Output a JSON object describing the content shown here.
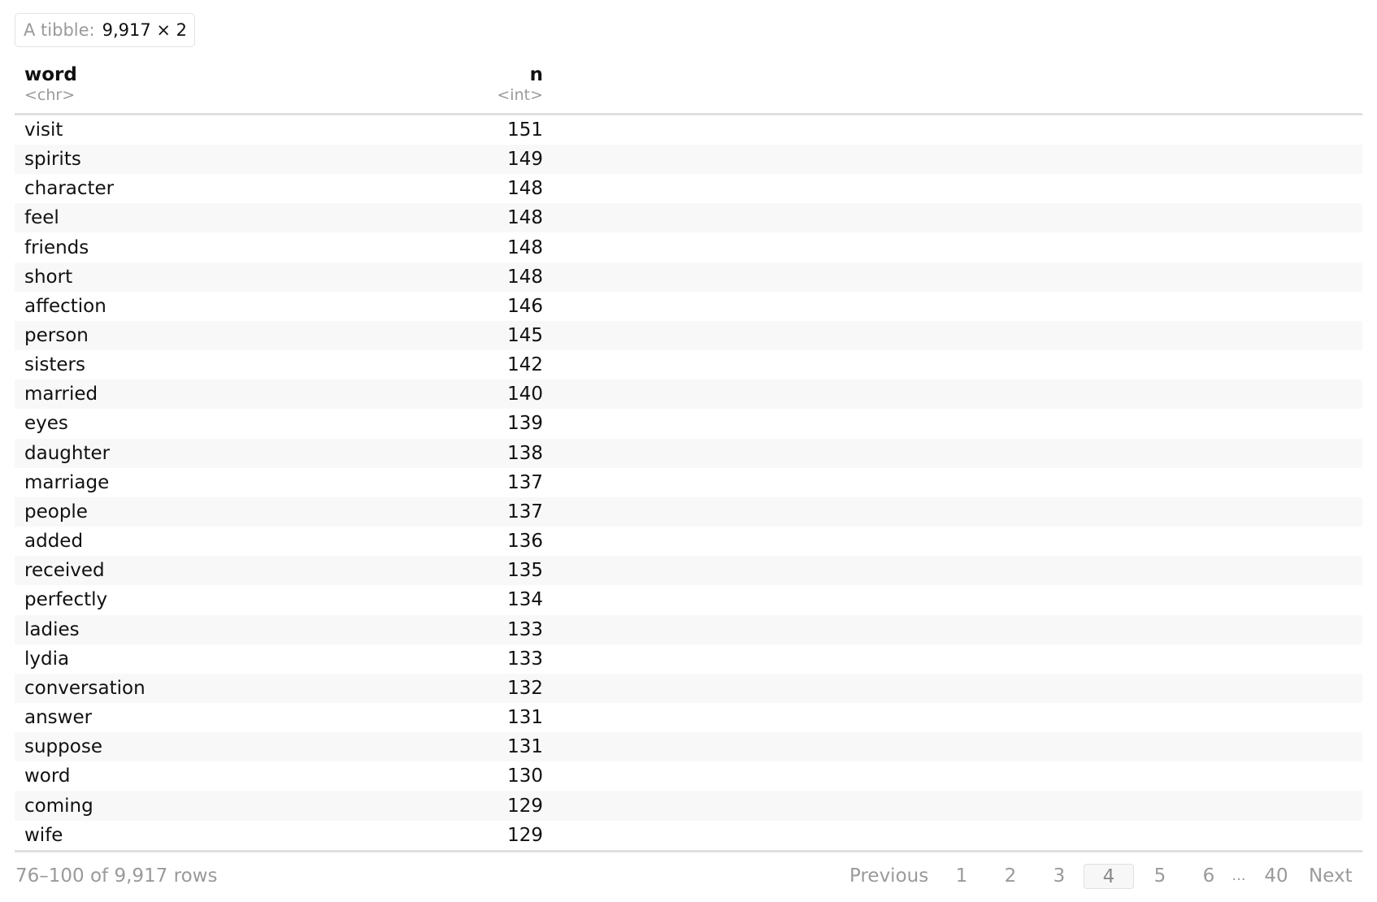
{
  "caption": {
    "label": "A tibble:",
    "dims": "9,917 × 2"
  },
  "columns": [
    {
      "name": "word",
      "type": "<chr>",
      "align": "left"
    },
    {
      "name": "n",
      "type": "<int>",
      "align": "right"
    }
  ],
  "rows": [
    {
      "word": "visit",
      "n": "151"
    },
    {
      "word": "spirits",
      "n": "149"
    },
    {
      "word": "character",
      "n": "148"
    },
    {
      "word": "feel",
      "n": "148"
    },
    {
      "word": "friends",
      "n": "148"
    },
    {
      "word": "short",
      "n": "148"
    },
    {
      "word": "affection",
      "n": "146"
    },
    {
      "word": "person",
      "n": "145"
    },
    {
      "word": "sisters",
      "n": "142"
    },
    {
      "word": "married",
      "n": "140"
    },
    {
      "word": "eyes",
      "n": "139"
    },
    {
      "word": "daughter",
      "n": "138"
    },
    {
      "word": "marriage",
      "n": "137"
    },
    {
      "word": "people",
      "n": "137"
    },
    {
      "word": "added",
      "n": "136"
    },
    {
      "word": "received",
      "n": "135"
    },
    {
      "word": "perfectly",
      "n": "134"
    },
    {
      "word": "ladies",
      "n": "133"
    },
    {
      "word": "lydia",
      "n": "133"
    },
    {
      "word": "conversation",
      "n": "132"
    },
    {
      "word": "answer",
      "n": "131"
    },
    {
      "word": "suppose",
      "n": "131"
    },
    {
      "word": "word",
      "n": "130"
    },
    {
      "word": "coming",
      "n": "129"
    },
    {
      "word": "wife",
      "n": "129"
    }
  ],
  "footer": {
    "row_info": "76–100 of 9,917 rows"
  },
  "pagination": {
    "previous_label": "Previous",
    "next_label": "Next",
    "pages": [
      "1",
      "2",
      "3",
      "4",
      "5",
      "6"
    ],
    "ellipsis": "...",
    "last_page": "40",
    "current_page": "4"
  },
  "colors": {
    "muted_text": "#9a9a9a",
    "stripe": "#f8f8f8",
    "border": "#e0e0e0"
  }
}
